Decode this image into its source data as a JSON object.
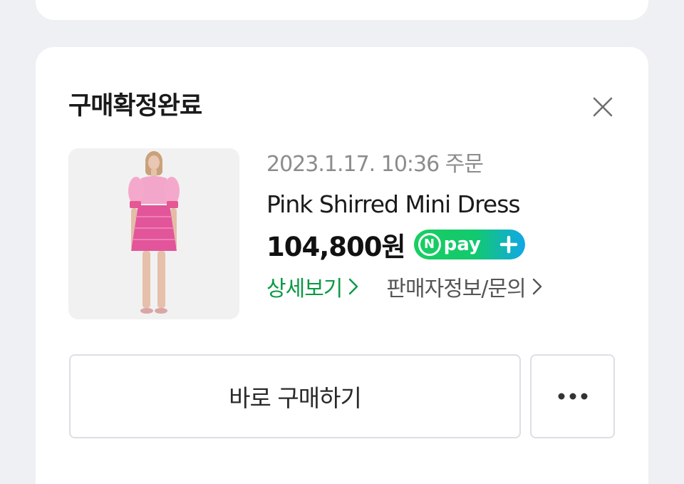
{
  "card": {
    "title": "구매확정완료",
    "order_date": "2023.1.17. 10:36 주문",
    "product_name": "Pink Shirred Mini Dress",
    "price": "104,800원",
    "npay": {
      "n_letter": "N",
      "label": "pay"
    },
    "detail_link": "상세보기",
    "seller_link": "판매자정보/문의",
    "buy_button": "바로 구매하기",
    "icons": {
      "close": "close-icon",
      "more": "more-horizontal-icon",
      "chevron": "chevron-right-icon",
      "npay_plus": "plus-icon"
    },
    "colors": {
      "accent_green": "#0a9a44",
      "npay_start": "#19ce60",
      "npay_end": "#11a7e8"
    }
  }
}
